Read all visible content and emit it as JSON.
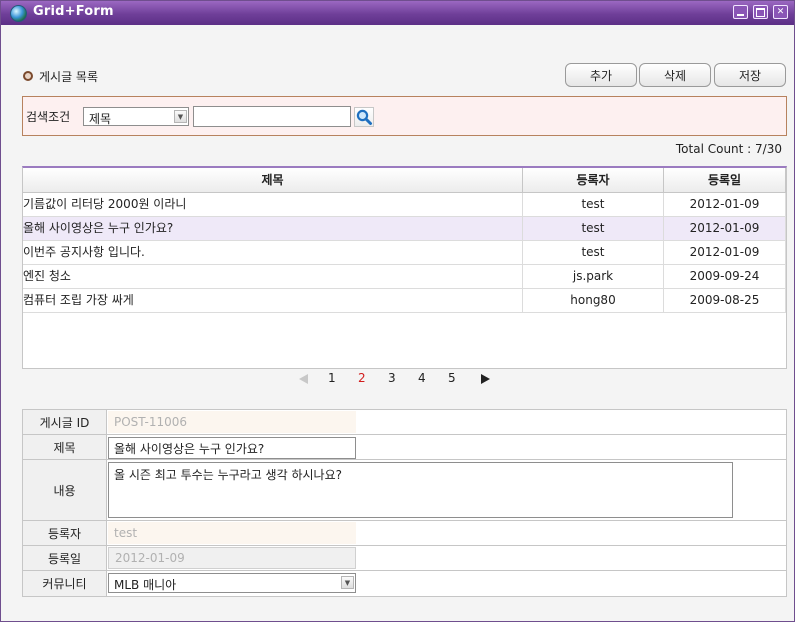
{
  "window": {
    "title": "Grid+Form",
    "buttons": [
      "minimize-icon",
      "maximize-icon",
      "close-icon"
    ]
  },
  "section": {
    "title": "게시글 목록"
  },
  "toolbar": {
    "add_label": "추가",
    "delete_label": "삭제",
    "save_label": "저장"
  },
  "search": {
    "label": "검색조건",
    "field_selected": "제목",
    "query": "",
    "button_icon": "magnifier-icon"
  },
  "grid": {
    "total_count": "Total Count : 7/30",
    "columns": [
      "제목",
      "등록자",
      "등록일"
    ],
    "rows": [
      {
        "title": "기름값이 리터당 2000원 이라니",
        "author": "test",
        "date": "2012-01-09",
        "selected": false
      },
      {
        "title": "올해 사이영상은 누구 인가요?",
        "author": "test",
        "date": "2012-01-09",
        "selected": true
      },
      {
        "title": "이번주 공지사항 입니다.",
        "author": "test",
        "date": "2012-01-09",
        "selected": false
      },
      {
        "title": "엔진 청소",
        "author": "js.park",
        "date": "2009-09-24",
        "selected": false
      },
      {
        "title": "컴퓨터 조립 가장 싸게",
        "author": "hong80",
        "date": "2009-08-25",
        "selected": false
      }
    ]
  },
  "pagination": {
    "pages": [
      "1",
      "2",
      "3",
      "4",
      "5"
    ],
    "current": "2"
  },
  "form": {
    "id_label": "게시글 ID",
    "id_value": "POST-11006",
    "title_label": "제목",
    "title_value": "올해 사이영상은 누구 인가요?",
    "content_label": "내용",
    "content_value": "올 시즌 최고 투수는 누구라고 생각 하시나요?",
    "author_label": "등록자",
    "author_value": "test",
    "date_label": "등록일",
    "date_value": "2012-01-09",
    "community_label": "커뮤니티",
    "community_value": "MLB 매니아"
  },
  "colors": {
    "titlebar": "#6f3f99",
    "header_accent": "#9b7bc0",
    "selected_row": "#efe9f8",
    "current_page": "#d21d1d",
    "search_bg": "#fdf0f0",
    "search_border": "#b7825e"
  }
}
